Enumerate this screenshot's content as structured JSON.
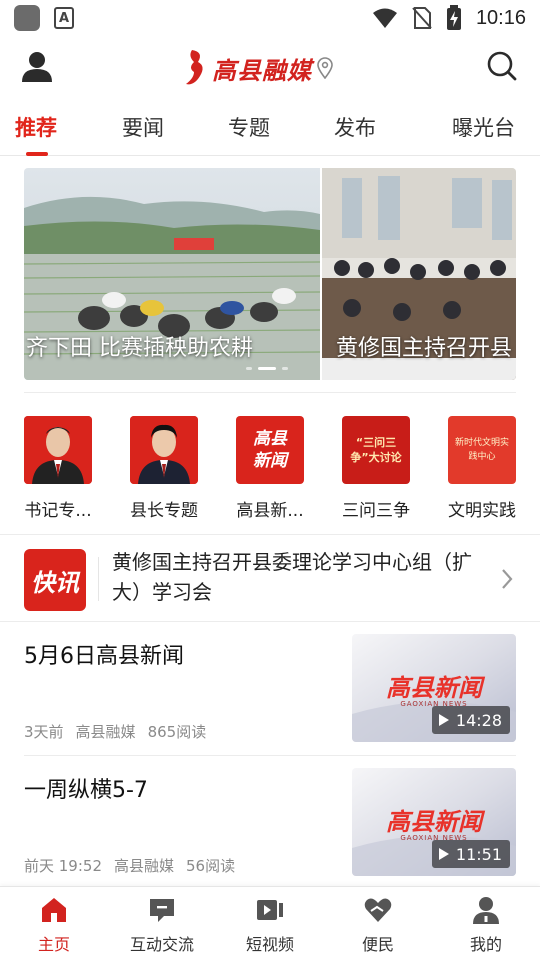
{
  "status_bar": {
    "time": "10:16",
    "notif_letter": "A"
  },
  "header": {
    "app_name": "高县融媒",
    "user_icon": "user-icon",
    "search_icon": "search-icon"
  },
  "tabs": [
    {
      "label": "推荐",
      "active": true
    },
    {
      "label": "要闻",
      "active": false
    },
    {
      "label": "专题",
      "active": false
    },
    {
      "label": "发布",
      "active": false
    },
    {
      "label": "曝光台",
      "active": false
    }
  ],
  "banner": {
    "slides": [
      {
        "caption": "齐下田 比赛插秧助农耕"
      },
      {
        "caption": "黄修国主持召开县"
      }
    ],
    "active_index": 1,
    "dot_count": 3
  },
  "channels": [
    {
      "label": "书记专..."
    },
    {
      "label": "县长专题"
    },
    {
      "label": "高县新...",
      "thumb_text": "高县新闻"
    },
    {
      "label": "三问三争",
      "thumb_text": "“三问三争”大讨论"
    },
    {
      "label": "文明实践",
      "thumb_text": "新时代文明实践中心"
    }
  ],
  "flash_news": {
    "icon_text": "快讯",
    "text": "黄修国主持召开县委理论学习中心组（扩大）学习会"
  },
  "news": [
    {
      "title": "5月6日高县新闻",
      "time": "3天前",
      "source": "高县融媒",
      "reads": "865阅读",
      "duration": "14:28",
      "thumb_text": "高县新闻",
      "thumb_sub": "GAOXIAN NEWS"
    },
    {
      "title": "一周纵横5-7",
      "time": "前天 19:52",
      "source": "高县融媒",
      "reads": "56阅读",
      "duration": "11:51",
      "thumb_text": "高县新闻",
      "thumb_sub": "GAOXIAN NEWS"
    }
  ],
  "bottom_nav": [
    {
      "label": "主页",
      "icon": "home-icon",
      "active": true
    },
    {
      "label": "互动交流",
      "icon": "chat-icon",
      "active": false
    },
    {
      "label": "短视频",
      "icon": "video-icon",
      "active": false
    },
    {
      "label": "便民",
      "icon": "heart-hand-icon",
      "active": false
    },
    {
      "label": "我的",
      "icon": "profile-icon",
      "active": false
    }
  ],
  "colors": {
    "accent": "#e1251b",
    "brand_red": "#d2231f",
    "meta_gray": "#8a8a8a"
  }
}
